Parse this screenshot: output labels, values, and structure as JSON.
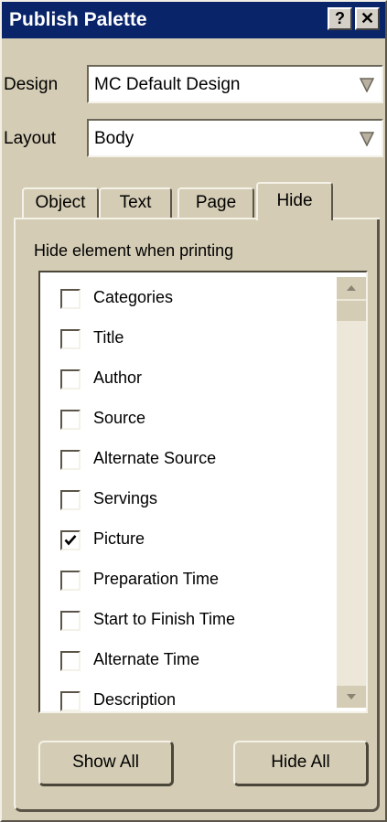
{
  "window": {
    "title": "Publish Palette",
    "help_label": "?",
    "close_label": "✕"
  },
  "design": {
    "label": "Design",
    "value": "MC Default Design"
  },
  "layout": {
    "label": "Layout",
    "value": "Body"
  },
  "tabs": [
    {
      "label": "Object",
      "active": false
    },
    {
      "label": "Text",
      "active": false
    },
    {
      "label": "Page",
      "active": false
    },
    {
      "label": "Hide",
      "active": true
    }
  ],
  "hide_panel": {
    "heading": "Hide element when printing",
    "items": [
      {
        "label": "Categories",
        "checked": false
      },
      {
        "label": "Title",
        "checked": false
      },
      {
        "label": "Author",
        "checked": false
      },
      {
        "label": "Source",
        "checked": false
      },
      {
        "label": "Alternate Source",
        "checked": false
      },
      {
        "label": "Servings",
        "checked": false
      },
      {
        "label": "Picture",
        "checked": true
      },
      {
        "label": "Preparation Time",
        "checked": false
      },
      {
        "label": "Start to Finish Time",
        "checked": false
      },
      {
        "label": "Alternate Time",
        "checked": false
      },
      {
        "label": "Description",
        "checked": false
      }
    ]
  },
  "buttons": {
    "show_all": "Show All",
    "hide_all": "Hide All"
  },
  "colors": {
    "titlebar": "#0a246a",
    "window_bg": "#d4ccb4"
  }
}
